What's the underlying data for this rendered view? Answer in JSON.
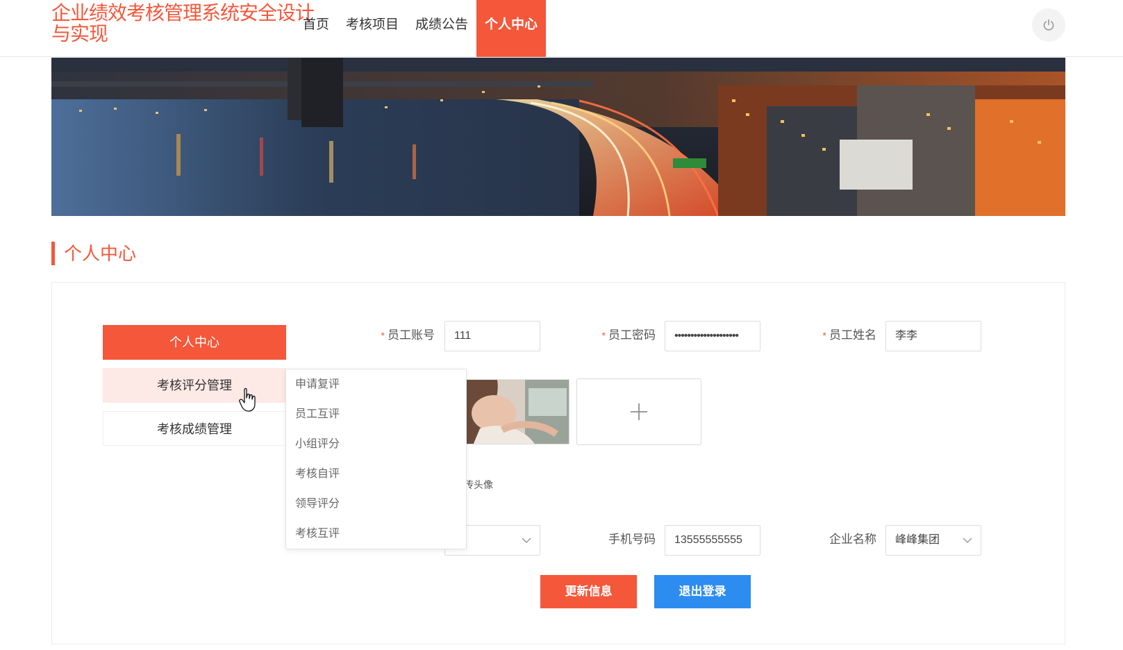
{
  "header": {
    "site_title": "企业绩效考核管理系统安全设计与实现",
    "nav": [
      "首页",
      "考核项目",
      "成绩公告",
      "个人中心"
    ],
    "active_nav": "个人中心",
    "accent_color": "#f4573a"
  },
  "page": {
    "section_title": "个人中心"
  },
  "sidebar": {
    "items": [
      {
        "label": "个人中心",
        "state": "active"
      },
      {
        "label": "考核评分管理",
        "state": "hover"
      },
      {
        "label": "考核成绩管理",
        "state": "normal"
      }
    ]
  },
  "dropdown": {
    "items": [
      "申请复评",
      "员工互评",
      "小组评分",
      "考核自评",
      "领导评分",
      "考核互评"
    ]
  },
  "form": {
    "account": {
      "label": "员工账号",
      "value": "111",
      "required": true
    },
    "password": {
      "label": "员工密码",
      "value": "••••••••••••••••••••",
      "required": true
    },
    "name": {
      "label": "员工姓名",
      "value": "李李",
      "required": true
    },
    "avatar": {
      "tip": "传头像"
    },
    "phone": {
      "label": "手机号码",
      "value": "13555555555"
    },
    "company": {
      "label": "企业名称",
      "value": "峰峰集团"
    }
  },
  "buttons": {
    "update": "更新信息",
    "logout": "退出登录",
    "update_color": "#f4573a",
    "logout_color": "#2d8cf0"
  },
  "icons": {
    "power": "power-icon",
    "upload": "plus-icon",
    "select": "chevron-down-icon",
    "cursor": "hand-pointer-icon"
  }
}
